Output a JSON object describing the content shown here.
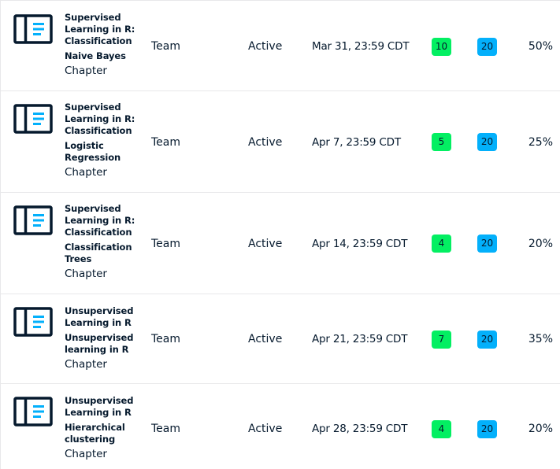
{
  "colors": {
    "completed_badge": "#03ef62",
    "total_badge": "#03b0fb",
    "icon_dark": "#05192d",
    "icon_accent": "#03b0fb"
  },
  "rows": [
    {
      "icon": "chapter-icon",
      "course": [
        "Supervised",
        "Learning in R:",
        "Classification"
      ],
      "chapter": [
        "Naive Bayes"
      ],
      "type": "Chapter",
      "assignee": "Team",
      "status": "Active",
      "due": "Mar 31, 23:59 CDT",
      "completed": "10",
      "total": "20",
      "percent": "50%"
    },
    {
      "icon": "chapter-icon",
      "course": [
        "Supervised",
        "Learning in R:",
        "Classification"
      ],
      "chapter": [
        "Logistic",
        "Regression"
      ],
      "type": "Chapter",
      "assignee": "Team",
      "status": "Active",
      "due": "Apr 7, 23:59 CDT",
      "completed": "5",
      "total": "20",
      "percent": "25%"
    },
    {
      "icon": "chapter-icon",
      "course": [
        "Supervised",
        "Learning in R:",
        "Classification"
      ],
      "chapter": [
        "Classification",
        "Trees"
      ],
      "type": "Chapter",
      "assignee": "Team",
      "status": "Active",
      "due": "Apr 14, 23:59 CDT",
      "completed": "4",
      "total": "20",
      "percent": "20%"
    },
    {
      "icon": "chapter-icon",
      "course": [
        "Unsupervised",
        "Learning in R"
      ],
      "chapter": [
        "Unsupervised",
        "learning in R"
      ],
      "type": "Chapter",
      "assignee": "Team",
      "status": "Active",
      "due": "Apr 21, 23:59 CDT",
      "completed": "7",
      "total": "20",
      "percent": "35%"
    },
    {
      "icon": "chapter-icon",
      "course": [
        "Unsupervised",
        "Learning in R"
      ],
      "chapter": [
        "Hierarchical",
        "clustering"
      ],
      "type": "Chapter",
      "assignee": "Team",
      "status": "Active",
      "due": "Apr 28, 23:59 CDT",
      "completed": "4",
      "total": "20",
      "percent": "20%"
    }
  ]
}
